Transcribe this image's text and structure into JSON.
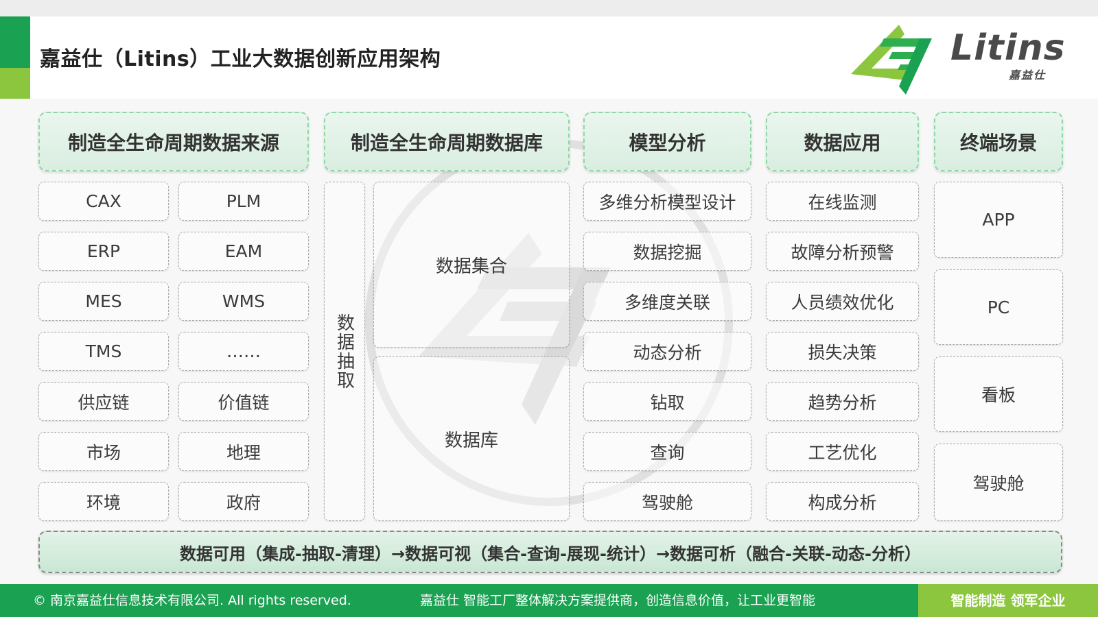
{
  "title": "嘉益仕（Litins）工业大数据创新应用架构",
  "logo": {
    "text": "Litins",
    "subtext": "嘉益仕"
  },
  "columns": {
    "sources": {
      "header": "制造全生命周期数据来源",
      "left": [
        "CAX",
        "ERP",
        "MES",
        "TMS",
        "供应链",
        "市场",
        "环境"
      ],
      "right": [
        "PLM",
        "EAM",
        "WMS",
        "……",
        "价值链",
        "地理",
        "政府"
      ]
    },
    "database": {
      "header": "制造全生命周期数据库",
      "extraction": "数据抽取",
      "collection": "数据集合",
      "store": "数据库"
    },
    "models": {
      "header": "模型分析",
      "items": [
        "多维分析模型设计",
        "数据挖掘",
        "多维度关联",
        "动态分析",
        "钻取",
        "查询",
        "驾驶舱"
      ]
    },
    "applications": {
      "header": "数据应用",
      "items": [
        "在线监测",
        "故障分析预警",
        "人员绩效优化",
        "损失决策",
        "趋势分析",
        "工艺优化",
        "构成分析"
      ]
    },
    "terminals": {
      "header": "终端场景",
      "items": [
        "APP",
        "PC",
        "看板",
        "驾驶舱"
      ]
    }
  },
  "summary": "数据可用（集成-抽取-清理）→数据可视（集合-查询-展现-统计）→数据可析（融合-关联-动态-分析）",
  "footer": {
    "copyright": "© 南京嘉益仕信息技术有限公司.  All rights reserved.",
    "tagline": "嘉益仕 智能工厂整体解决方案提供商，创造信息价值，让工业更智能",
    "motto": "智能制造  领军企业"
  },
  "colors": {
    "brand_green": "#1aa152",
    "accent_lime": "#8cc63f",
    "header_fill": "#d9eee0",
    "header_border": "#8fd6a6"
  }
}
